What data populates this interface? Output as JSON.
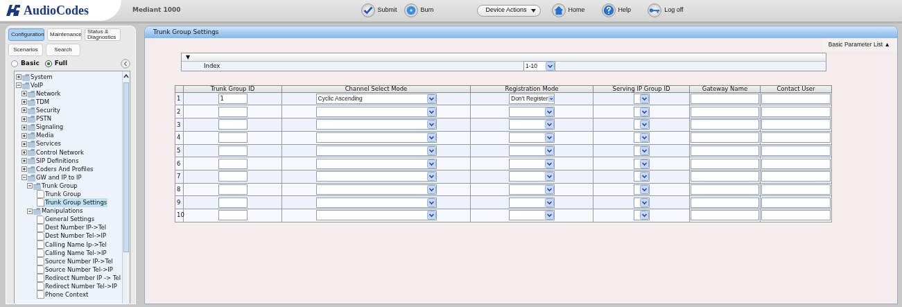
{
  "header": {
    "logo": "AudioCodes",
    "product": "Mediant 1000"
  },
  "toolbar": [
    {
      "kind": "submit",
      "label": "Submit"
    },
    {
      "kind": "burn",
      "label": "Burn"
    },
    {
      "kind": "dropdown",
      "label": "Device Actions"
    },
    {
      "kind": "home",
      "label": "Home"
    },
    {
      "kind": "help",
      "label": "Help"
    },
    {
      "kind": "logoff",
      "label": "Log off"
    }
  ],
  "nav_tabs": [
    {
      "label": "Configuration",
      "selected": true
    },
    {
      "label": "Maintenance",
      "selected": false
    },
    {
      "label": "Status & Diagnostics",
      "selected": false
    },
    {
      "label": "Scenarios",
      "selected": false
    },
    {
      "label": "Search",
      "selected": false
    }
  ],
  "view_modes": [
    {
      "label": "Basic",
      "selected": false
    },
    {
      "label": "Full",
      "selected": true
    }
  ],
  "tree": [
    {
      "label": "System",
      "kind": "folder",
      "expanded": false
    },
    {
      "label": "VoIP",
      "kind": "folder",
      "expanded": true,
      "children": [
        {
          "label": "Network",
          "kind": "folder",
          "expanded": false
        },
        {
          "label": "TDM",
          "kind": "folder",
          "expanded": false
        },
        {
          "label": "Security",
          "kind": "folder",
          "expanded": false
        },
        {
          "label": "PSTN",
          "kind": "folder",
          "expanded": false
        },
        {
          "label": "Signaling",
          "kind": "folder",
          "expanded": false
        },
        {
          "label": "Media",
          "kind": "folder",
          "expanded": false
        },
        {
          "label": "Services",
          "kind": "folder",
          "expanded": false
        },
        {
          "label": "Control Network",
          "kind": "folder",
          "expanded": false
        },
        {
          "label": "SIP Definitions",
          "kind": "folder",
          "expanded": false
        },
        {
          "label": "Coders And Profiles",
          "kind": "folder",
          "expanded": false
        },
        {
          "label": "GW and IP to IP",
          "kind": "folder",
          "expanded": true,
          "children": [
            {
              "label": "Trunk Group",
              "kind": "folder",
              "expanded": true,
              "children": [
                {
                  "label": "Trunk Group",
                  "kind": "page",
                  "selected": false
                },
                {
                  "label": "Trunk Group Settings",
                  "kind": "page",
                  "selected": true
                }
              ]
            },
            {
              "label": "Manipulations",
              "kind": "folder",
              "expanded": true,
              "children": [
                {
                  "label": "General Settings",
                  "kind": "page",
                  "selected": false
                },
                {
                  "label": "Dest Number IP->Tel",
                  "kind": "page",
                  "selected": false
                },
                {
                  "label": "Dest Number Tel->IP",
                  "kind": "page",
                  "selected": false
                },
                {
                  "label": "Calling Name Ip->Tel",
                  "kind": "page",
                  "selected": false
                },
                {
                  "label": "Calling Name Tel->IP",
                  "kind": "page",
                  "selected": false
                },
                {
                  "label": "Source Number IP->Tel",
                  "kind": "page",
                  "selected": false
                },
                {
                  "label": "Source Number Tel->IP",
                  "kind": "page",
                  "selected": false
                },
                {
                  "label": "Redirect Number IP -> Tel",
                  "kind": "page",
                  "selected": false
                },
                {
                  "label": "Redirect Number Tel->IP",
                  "kind": "page",
                  "selected": false
                },
                {
                  "label": "Phone Context",
                  "kind": "page",
                  "selected": false
                }
              ]
            }
          ]
        }
      ]
    }
  ],
  "panel": {
    "title": "Trunk Group Settings",
    "parameter_list": "Basic Parameter List",
    "parameter_list_toggle": "▲",
    "index_section": {
      "toggle": "▼",
      "label": "Index",
      "value": "1-10"
    },
    "table": {
      "columns": [
        "Trunk Group ID",
        "Channel Select Mode",
        "Registration Mode",
        "Serving IP Group ID",
        "Gateway Name",
        "Contact User"
      ],
      "rows": [
        {
          "index": "1",
          "trunk_group_id": "1",
          "channel_select_mode": "Cyclic Ascending",
          "registration_mode": "Don't Register"
        },
        {
          "index": "2"
        },
        {
          "index": "3"
        },
        {
          "index": "4"
        },
        {
          "index": "5"
        },
        {
          "index": "6"
        },
        {
          "index": "7"
        },
        {
          "index": "8"
        },
        {
          "index": "9"
        },
        {
          "index": "10"
        }
      ]
    }
  }
}
